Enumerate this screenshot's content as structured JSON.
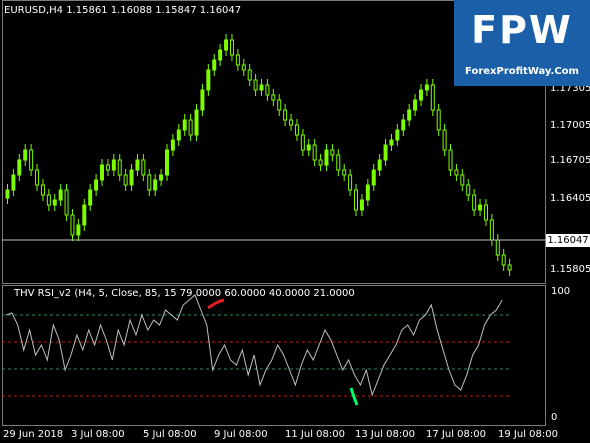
{
  "main_chart": {
    "header": "EURUSD,H4  1.15861 1.16088 1.15847 1.16047",
    "price_ticks": [
      "1.17305",
      "1.17005",
      "1.16705",
      "1.16405",
      "1.15805"
    ],
    "current_price": "1.16047"
  },
  "indicator": {
    "header": "THV RSI_v2  (H4, 5, Close, 85, 15 79.0000 60.0000 40.0000 21.0000",
    "scale_ticks": [
      "100",
      "0"
    ]
  },
  "time_axis": {
    "ticks": [
      "29 Jun 2018",
      "3 Jul 08:00",
      "5 Jul 08:00",
      "9 Jul 08:00",
      "11 Jul 08:00",
      "13 Jul 08:00",
      "17 Jul 08:00",
      "19 Jul 08:00"
    ]
  },
  "logo": {
    "main": "FPW",
    "site": "ForexProfitWay.Com"
  },
  "colors": {
    "bull": "#7cfc00",
    "bear": "#32cd32",
    "line": "#c0c0c0",
    "level_green": "#2e8b57",
    "level_red": "#b22222",
    "accent_red": "#e02020",
    "accent_green": "#00ff66"
  }
}
